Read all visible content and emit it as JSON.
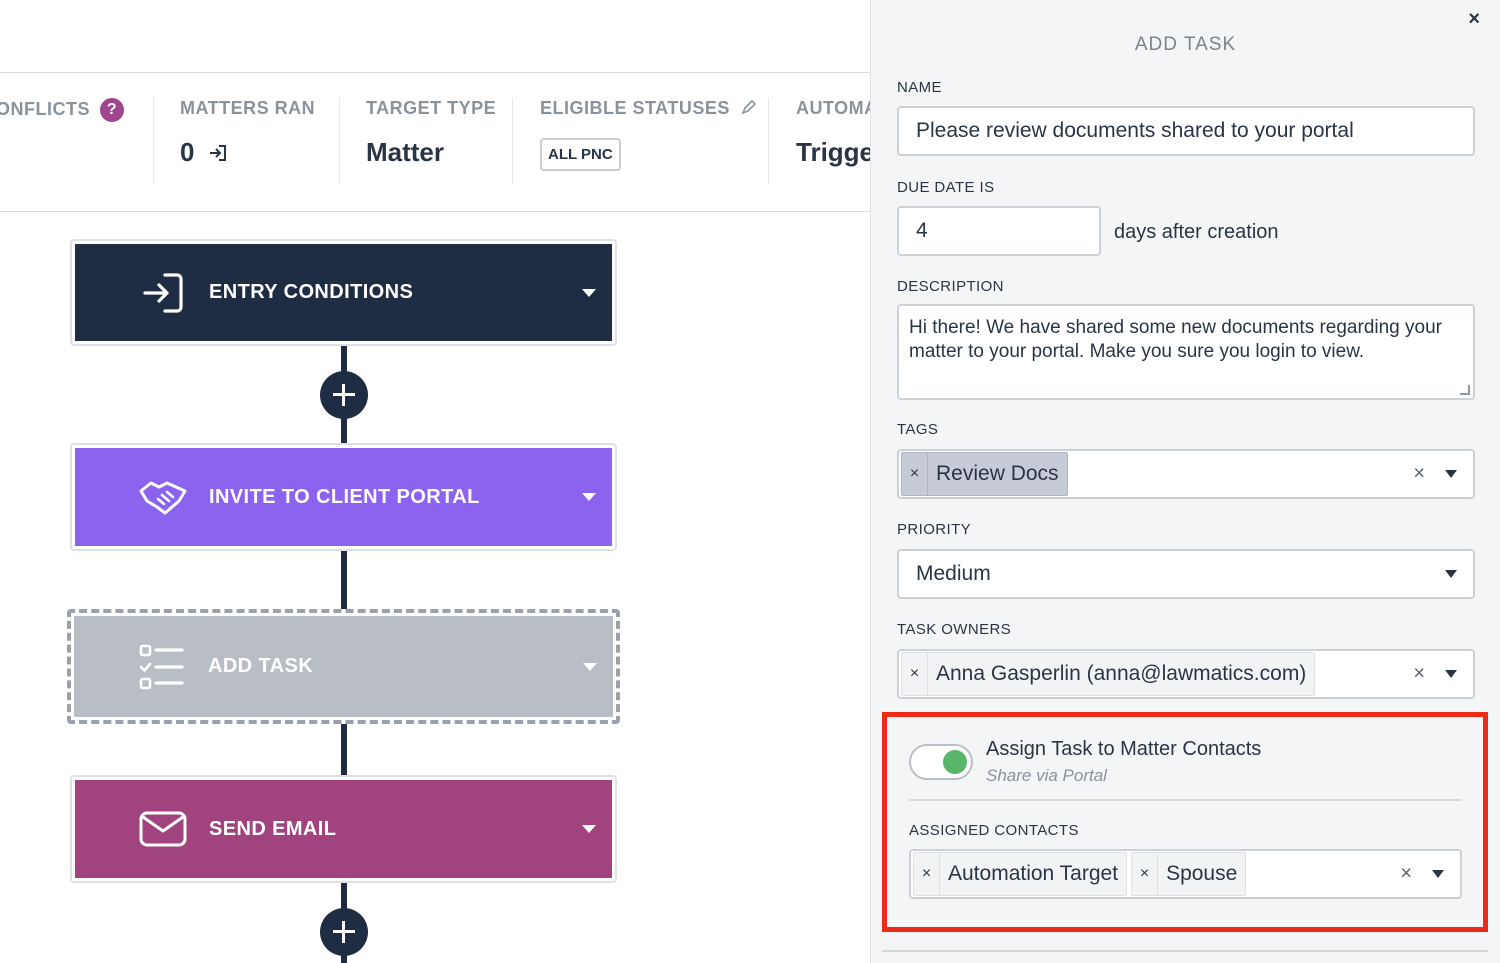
{
  "stats": [
    {
      "label": "ONFLICTS",
      "help_icon": "question-icon"
    },
    {
      "label": "MATTERS RAN",
      "value": "0",
      "icon": "arrow-into-icon"
    },
    {
      "label": "TARGET TYPE",
      "value": "Matter"
    },
    {
      "label": "ELIGIBLE STATUSES",
      "badge": "ALL PNC",
      "icon": "pencil-icon"
    },
    {
      "label": "AUTOMA",
      "value": "Trigge"
    }
  ],
  "steps": [
    {
      "title": "ENTRY CONDITIONS",
      "color": "#1e2c44",
      "icon": "sign-in-icon"
    },
    {
      "title": "INVITE TO CLIENT PORTAL",
      "color": "#8b63ee",
      "icon": "handshake-icon"
    },
    {
      "title": "ADD TASK",
      "color": "#b9bec6",
      "icon": "checklist-icon"
    },
    {
      "title": "SEND EMAIL",
      "color": "#a0437f",
      "icon": "envelope-icon"
    }
  ],
  "panel": {
    "title": "ADD TASK",
    "close_label": "×",
    "name_label": "NAME",
    "name_value": "Please review documents shared to your portal",
    "due_label": "DUE DATE IS",
    "due_value": "4",
    "due_suffix": "days after creation",
    "description_label": "DESCRIPTION",
    "description_value": "Hi there! We have shared some new documents regarding your matter to your portal. Make you sure you login to view.",
    "tags_label": "TAGS",
    "tags": [
      "Review Docs"
    ],
    "priority_label": "PRIORITY",
    "priority_value": "Medium",
    "owners_label": "TASK OWNERS",
    "owners": [
      "Anna Gasperlin (anna@lawmatics.com)"
    ],
    "assign_title": "Assign Task to Matter Contacts",
    "assign_subtitle": "Share via Portal",
    "assign_enabled": true,
    "contacts_label": "ASSIGNED CONTACTS",
    "contacts": [
      "Automation Target",
      "Spouse"
    ],
    "chip_remove": "×",
    "clear_label": "×"
  },
  "colors": {
    "highlight": "#ef2a17",
    "toggle_on": "#58b66a",
    "help": "#a1458f"
  }
}
